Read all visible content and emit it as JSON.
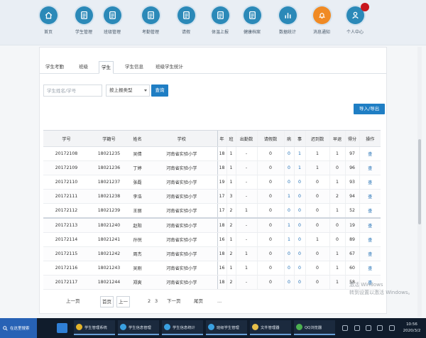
{
  "colors": {
    "accent": "#1f7ec4",
    "nav": "#2b89b8",
    "nav_alt": "#f08a24",
    "badge": "#c8161d",
    "taskbar": "#101c2c"
  },
  "nav": [
    {
      "label": "首页",
      "icon": "home-icon",
      "color": "#2b89b8"
    },
    {
      "label": "学生管理",
      "icon": "list-icon",
      "color": "#2b89b8"
    },
    {
      "label": "班级管理",
      "icon": "document-icon",
      "color": "#2b89b8"
    },
    {
      "label": "考勤管理",
      "icon": "clipboard-icon",
      "color": "#2b89b8"
    },
    {
      "label": "请假",
      "icon": "document-icon",
      "color": "#2b89b8"
    },
    {
      "label": "体温上报",
      "icon": "thermometer-icon",
      "color": "#2b89b8"
    },
    {
      "label": "健康档案",
      "icon": "folder-icon",
      "color": "#2b89b8"
    },
    {
      "label": "数据统计",
      "icon": "chart-icon",
      "color": "#2b89b8"
    },
    {
      "label": "消息通知",
      "icon": "bell-icon",
      "color": "#f08a24"
    },
    {
      "label": "个人中心",
      "icon": "user-icon",
      "color": "#2b89b8"
    }
  ],
  "tabs": [
    {
      "label": "学生考勤",
      "active": false
    },
    {
      "label": "班级",
      "active": false
    },
    {
      "label": "学生",
      "active": true
    },
    {
      "label": "学生信息",
      "active": false
    },
    {
      "label": "班级学生统计",
      "active": false
    }
  ],
  "search": {
    "placeholder": "学生姓名/学号",
    "select_value": "按上报类型",
    "button": "查询"
  },
  "export_button": "导入/导出",
  "table": {
    "headers": [
      "学号",
      "学籍号",
      "姓名",
      "学校",
      "年",
      "班",
      "出勤数",
      "请假数",
      "病",
      "事",
      "迟到数",
      "早退",
      "得分",
      "操作"
    ],
    "rows": [
      [
        "20172108",
        "18021235",
        "吴倩",
        "河南省实验小学",
        "18",
        "1",
        "-",
        "0",
        "0",
        "1",
        "1",
        "1",
        "97",
        "查"
      ],
      [
        "20172109",
        "18021236",
        "丁婷",
        "河南省实验小学",
        "18",
        "1",
        "-",
        "0",
        "0",
        "1",
        "1",
        "0",
        "96",
        "查"
      ],
      [
        "20172110",
        "18021237",
        "张磊",
        "河南省实验小学",
        "19",
        "1",
        "-",
        "0",
        "0",
        "0",
        "0",
        "1",
        "93",
        "查"
      ],
      [
        "20172111",
        "18021238",
        "李浩",
        "河南省实验小学",
        "17",
        "3",
        "-",
        "0",
        "1",
        "0",
        "0",
        "2",
        "94",
        "查"
      ],
      [
        "20172112",
        "18021239",
        "王丽",
        "河南省实验小学",
        "17",
        "2",
        "1",
        "0",
        "0",
        "0",
        "0",
        "1",
        "52",
        "查"
      ],
      [
        "20172113",
        "18021240",
        "赵阳",
        "河南省实验小学",
        "18",
        "2",
        "-",
        "0",
        "1",
        "0",
        "0",
        "0",
        "19",
        "查"
      ],
      [
        "20172114",
        "18021241",
        "孙悦",
        "河南省实验小学",
        "16",
        "1",
        "-",
        "0",
        "1",
        "0",
        "1",
        "0",
        "89",
        "查"
      ],
      [
        "20172115",
        "18021242",
        "周杰",
        "河南省实验小学",
        "18",
        "2",
        "1",
        "0",
        "0",
        "0",
        "0",
        "1",
        "67",
        "查"
      ],
      [
        "20172116",
        "18021243",
        "吴刚",
        "河南省实验小学",
        "16",
        "1",
        "1",
        "0",
        "0",
        "0",
        "0",
        "1",
        "60",
        "查"
      ],
      [
        "20172117",
        "18021244",
        "郑爽",
        "河南省实验小学",
        "18",
        "2",
        "-",
        "0",
        "0",
        "0",
        "0",
        "1",
        "58",
        "查"
      ]
    ]
  },
  "pagination": [
    "上一页",
    "首页",
    "上一",
    "2",
    "3",
    "下一页",
    "尾页",
    "..."
  ],
  "watermark": {
    "line1": "激活 Windows",
    "line2": "转到设置以激活 Windows。"
  },
  "taskbar": {
    "search_text": "在这里搜索",
    "quick_color": "#2f7fd6",
    "apps": [
      {
        "label": "学生管理系统",
        "icon_color": "#e3b32a"
      },
      {
        "label": "学生信息管理",
        "icon_color": "#3aa0e0"
      },
      {
        "label": "学生信息统计",
        "icon_color": "#3aa0e0"
      },
      {
        "label": "班级学生管理",
        "icon_color": "#3aa0e0"
      },
      {
        "label": "文件管理器",
        "icon_color": "#e8c04a"
      },
      {
        "label": "QQ浏览器",
        "icon_color": "#4cb050"
      }
    ],
    "time": "10:56",
    "date": "2020/3/2"
  }
}
